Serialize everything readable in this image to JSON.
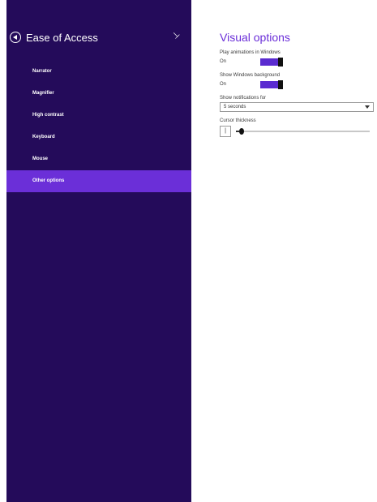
{
  "sidebar": {
    "title": "Ease of Access",
    "items": [
      {
        "label": "Narrator",
        "active": false
      },
      {
        "label": "Magnifier",
        "active": false
      },
      {
        "label": "High contrast",
        "active": false
      },
      {
        "label": "Keyboard",
        "active": false
      },
      {
        "label": "Mouse",
        "active": false
      },
      {
        "label": "Other options",
        "active": true
      }
    ]
  },
  "main": {
    "heading": "Visual options",
    "play_animations": {
      "label": "Play animations in Windows",
      "state": "On"
    },
    "show_background": {
      "label": "Show Windows background",
      "state": "On"
    },
    "notifications": {
      "label": "Show notifications for",
      "value": "5 seconds"
    },
    "cursor_thickness": {
      "label": "Cursor thickness",
      "preview": "|",
      "value": 1,
      "min": 1,
      "max": 20
    }
  },
  "colors": {
    "sidebar_bg": "#240b5a",
    "accent": "#6b2fd8"
  }
}
